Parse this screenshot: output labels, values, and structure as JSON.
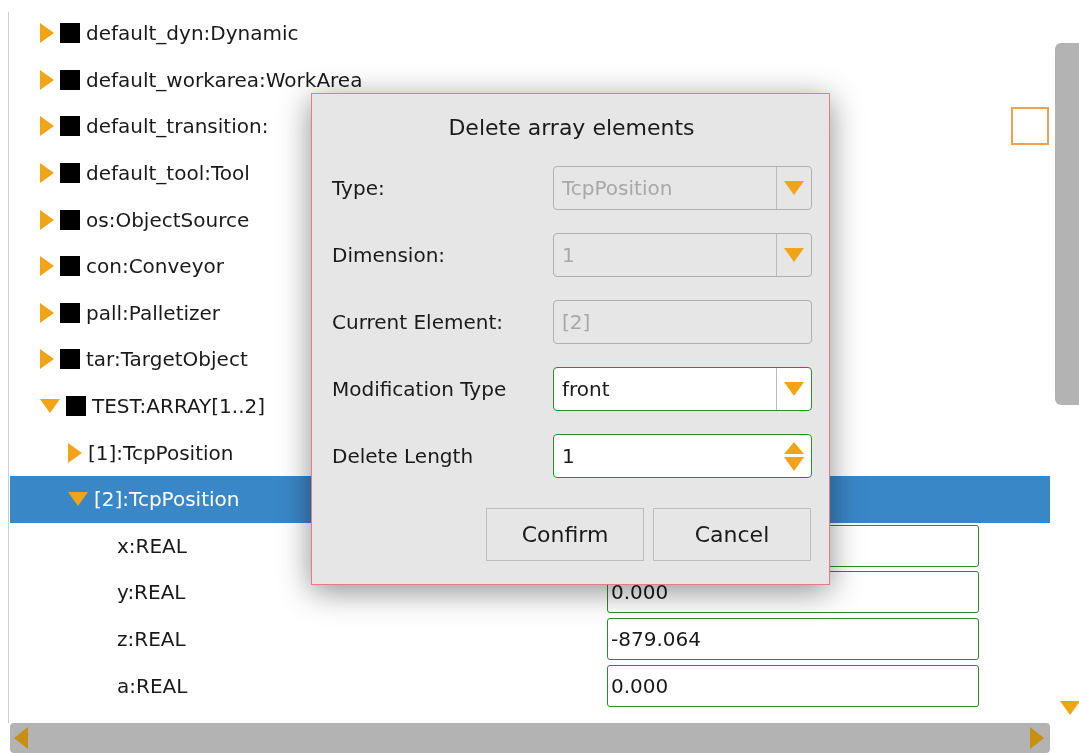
{
  "tree": [
    {
      "label": "default_dyn:Dynamic",
      "kind": "variable",
      "expanded": false
    },
    {
      "label": "default_workarea:WorkArea",
      "kind": "variable",
      "expanded": false
    },
    {
      "label": "default_transition:",
      "kind": "variable",
      "expanded": false
    },
    {
      "label": "default_tool:Tool",
      "kind": "variable",
      "expanded": false
    },
    {
      "label": "os:ObjectSource",
      "kind": "variable",
      "expanded": false
    },
    {
      "label": "con:Conveyor",
      "kind": "variable",
      "expanded": false
    },
    {
      "label": "pall:Palletizer",
      "kind": "variable",
      "expanded": false
    },
    {
      "label": "tar:TargetObject",
      "kind": "variable",
      "expanded": false
    },
    {
      "label": "TEST:ARRAY[1..2]",
      "kind": "variable",
      "expanded": true,
      "children": [
        {
          "label": "[1]:TcpPosition",
          "kind": "element",
          "expanded": false,
          "selected": false
        },
        {
          "label": "[2]:TcpPosition",
          "kind": "element",
          "expanded": true,
          "selected": true,
          "children": [
            {
              "label": "x:REAL",
              "kind": "member"
            },
            {
              "label": "y:REAL",
              "kind": "member",
              "value": "0.000"
            },
            {
              "label": "z:REAL",
              "kind": "member",
              "value": "-879.064"
            },
            {
              "label": "a:REAL",
              "kind": "member",
              "value": "0.000"
            }
          ]
        }
      ]
    }
  ],
  "dialog": {
    "title": "Delete array elements",
    "fields": [
      {
        "label": "Type:",
        "kind": "dropdown",
        "value": "TcpPosition",
        "disabled": true
      },
      {
        "label": "Dimension:",
        "kind": "dropdown",
        "value": "1",
        "disabled": true
      },
      {
        "label": "Current Element:",
        "kind": "text",
        "value": "[2]",
        "disabled": true
      },
      {
        "label": "Modification Type",
        "kind": "dropdown",
        "value": "front",
        "disabled": false
      },
      {
        "label": "Delete Length",
        "kind": "spinner",
        "value": "1",
        "disabled": false
      }
    ],
    "buttons": [
      "Confirm",
      "Cancel"
    ]
  }
}
